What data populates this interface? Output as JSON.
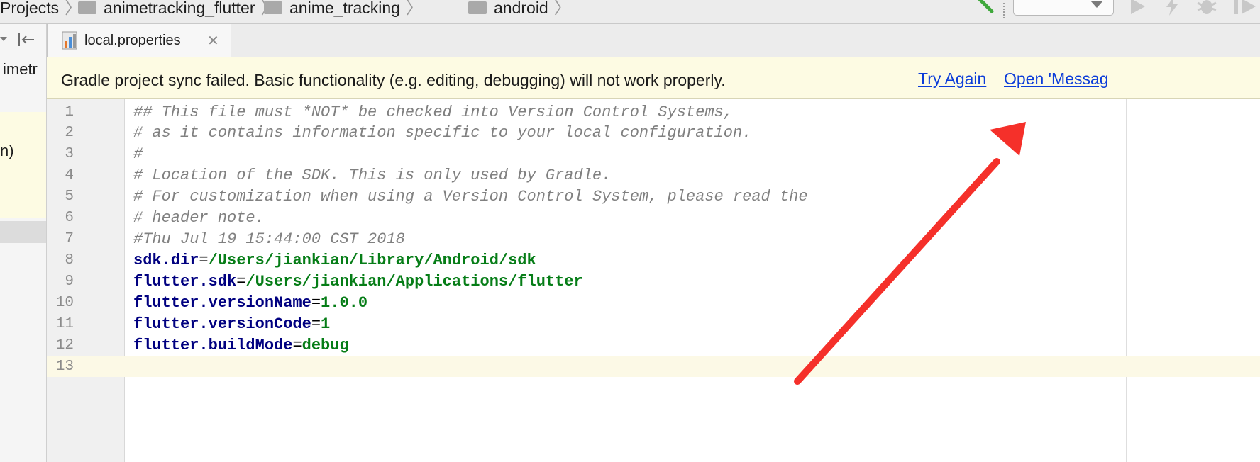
{
  "breadcrumb": {
    "items": [
      "Projects",
      "animetracking_flutter",
      "anime_tracking",
      "android"
    ]
  },
  "toolbar": {
    "build_icon": "hammer-icon",
    "config_value": "",
    "run_icon": "run-icon",
    "apply_changes_icon": "lightning-icon",
    "debug_icon": "bug-icon",
    "profile_icon": "profile-icon"
  },
  "project_panel": {
    "partial_item": "imetr",
    "partial_suffix": "n)"
  },
  "tabs": [
    {
      "label": "local.properties",
      "icon": "properties-file-icon",
      "active": true
    }
  ],
  "banner": {
    "message": "Gradle project sync failed. Basic functionality (e.g. editing, debugging) will not work properly.",
    "try_again": "Try Again",
    "open_messages": "Open 'Messag"
  },
  "editor": {
    "lines": [
      {
        "no": "1",
        "comment": "## This file must *NOT* be checked into Version Control Systems,"
      },
      {
        "no": "2",
        "comment": "# as it contains information specific to your local configuration."
      },
      {
        "no": "3",
        "comment": "#"
      },
      {
        "no": "4",
        "comment": "# Location of the SDK. This is only used by Gradle."
      },
      {
        "no": "5",
        "comment": "# For customization when using a Version Control System, please read the"
      },
      {
        "no": "6",
        "comment": "# header note."
      },
      {
        "no": "7",
        "comment": "#Thu Jul 19 15:44:00 CST 2018"
      },
      {
        "no": "8",
        "key": "sdk.dir",
        "eq": "=",
        "value": "/Users/jiankian/Library/Android/sdk"
      },
      {
        "no": "9",
        "key": "flutter.sdk",
        "eq": "=",
        "value": "/Users/jiankian/Applications/flutter"
      },
      {
        "no": "10",
        "key": "flutter.versionName",
        "eq": "=",
        "value": "1.0.0"
      },
      {
        "no": "11",
        "key": "flutter.versionCode",
        "eq": "=",
        "value": "1"
      },
      {
        "no": "12",
        "key": "flutter.buildMode",
        "eq": "=",
        "value": "debug"
      },
      {
        "no": "13"
      }
    ]
  },
  "annotation": {
    "color": "#f5302a",
    "icon": "red-arrow-annotation-icon"
  }
}
